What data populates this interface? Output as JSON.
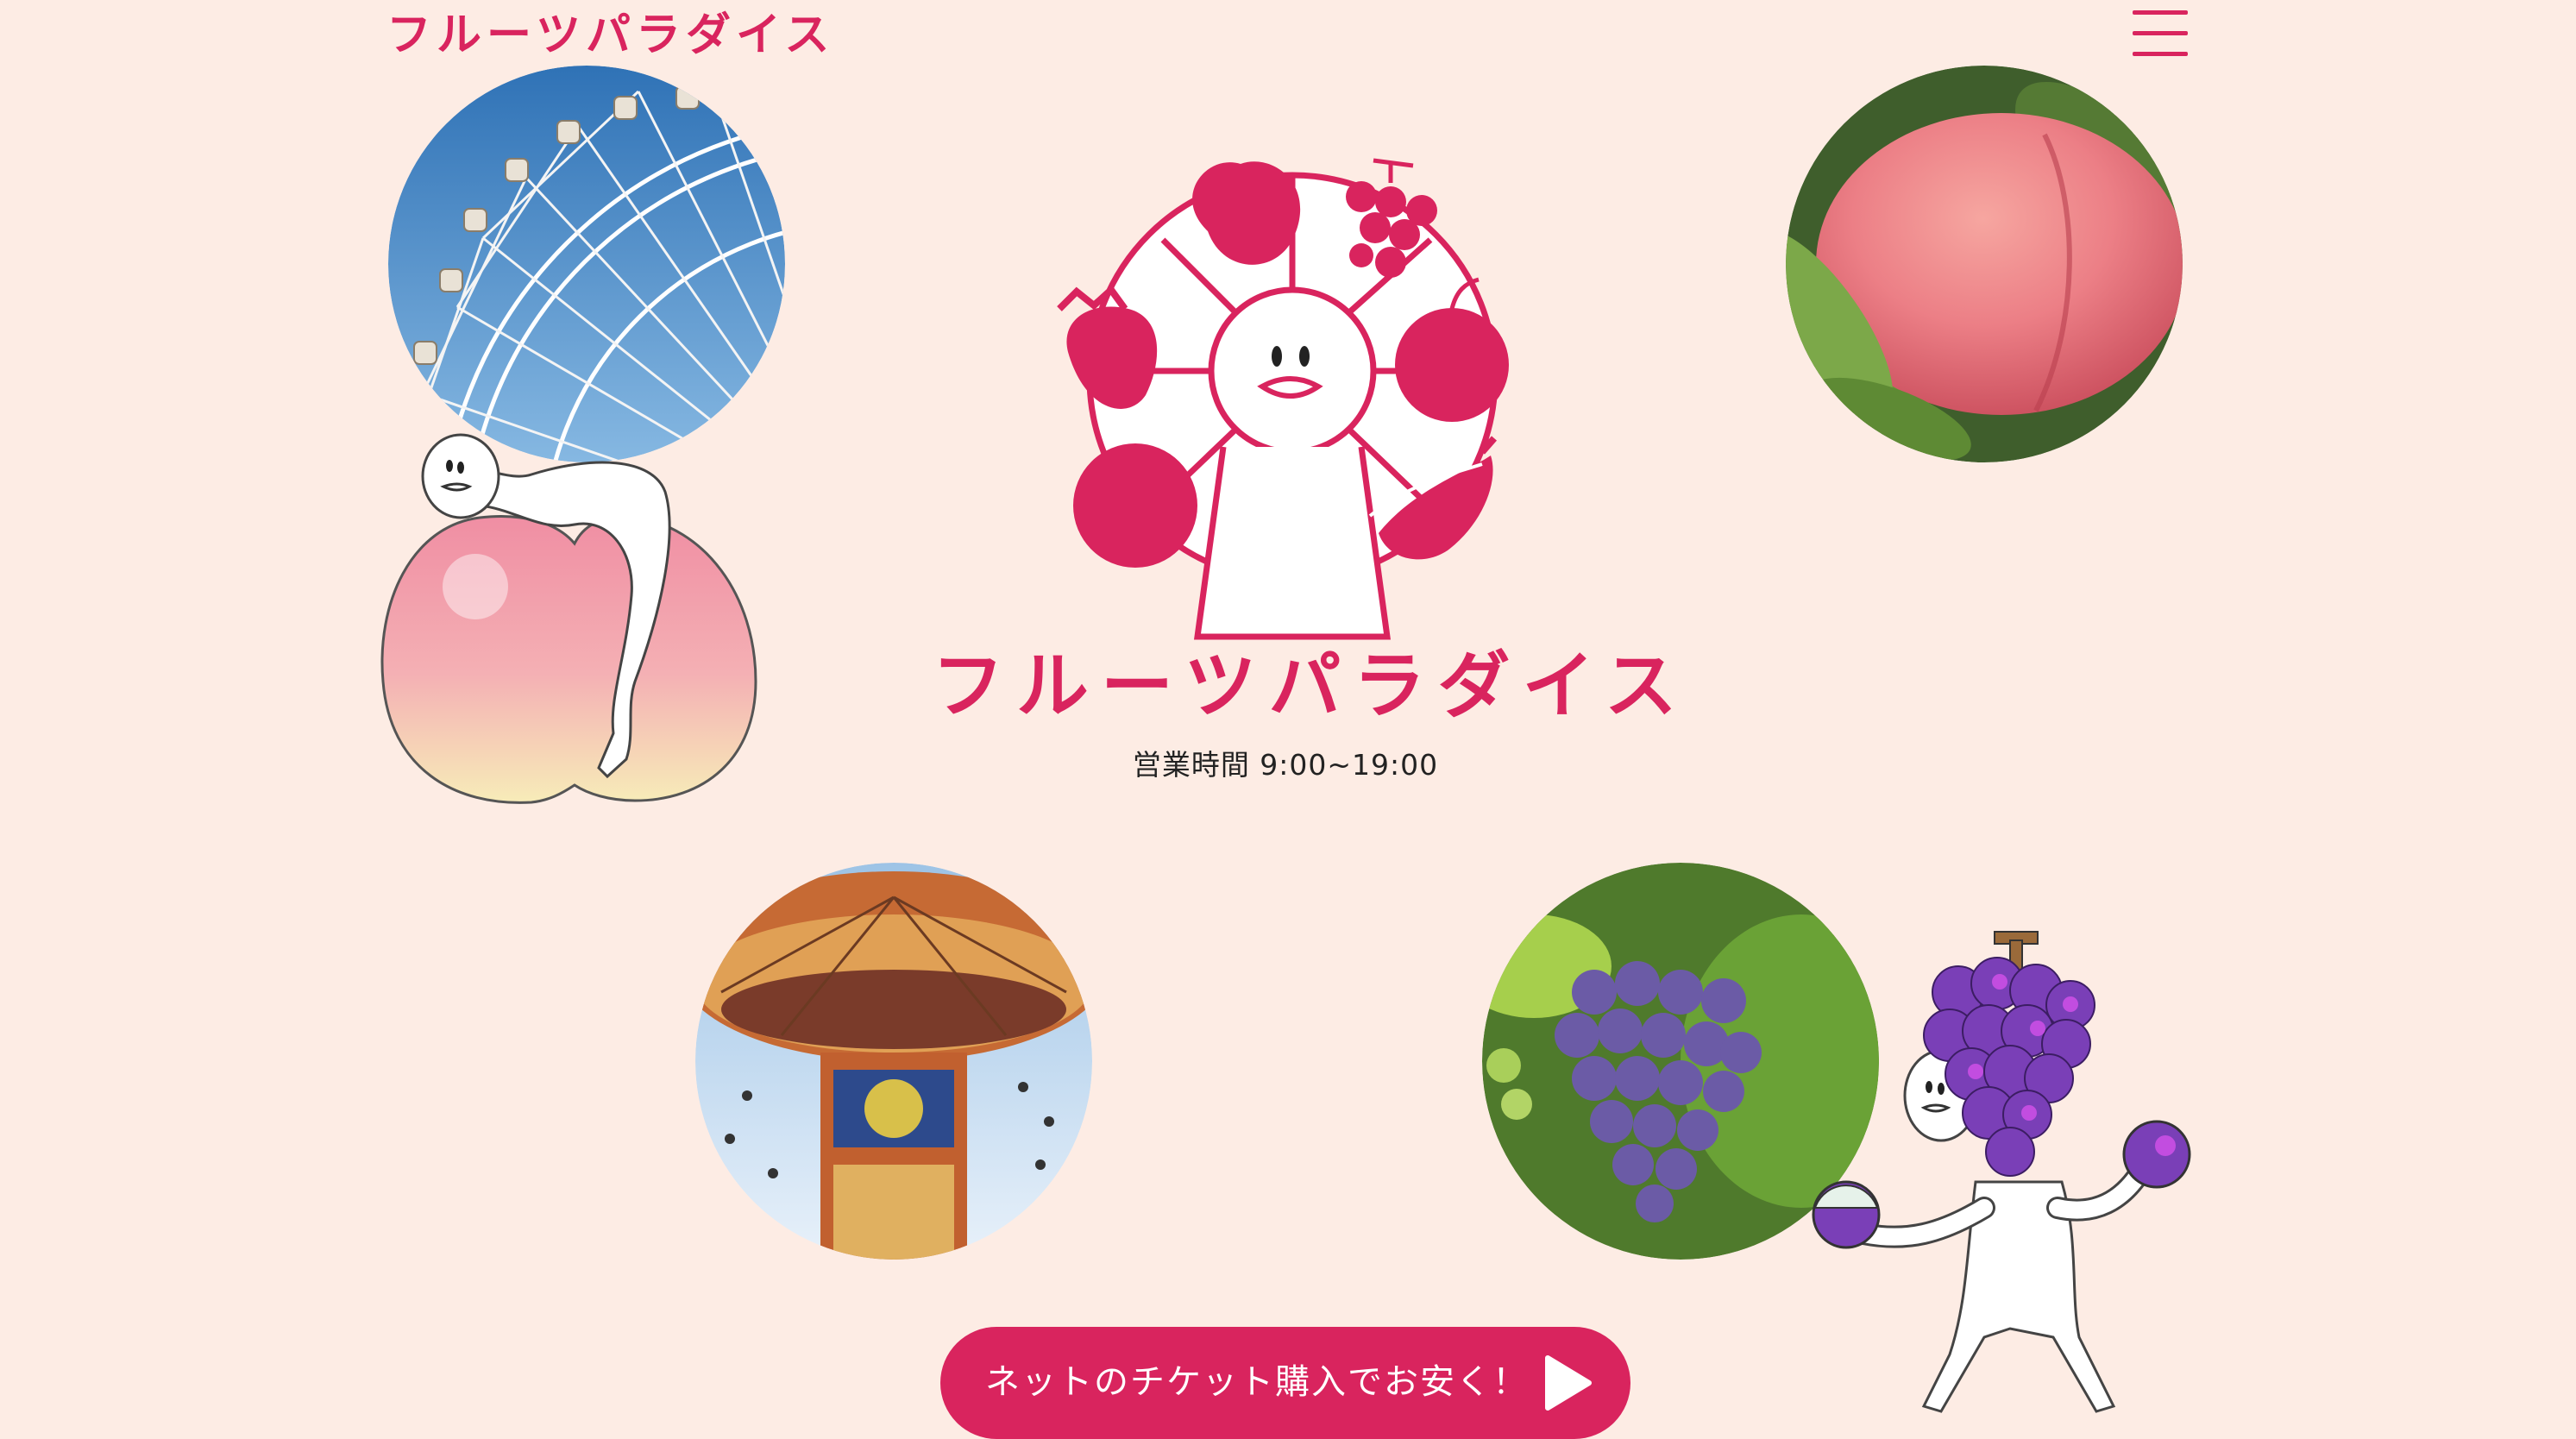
{
  "header": {
    "logo_text": "フルーツパラダイス",
    "menu_icon": "hamburger-menu-icon"
  },
  "hero": {
    "title": "フルーツパラダイス",
    "hours": "営業時間 9:00~19:00"
  },
  "photos": [
    {
      "name": "ferris-wheel-photo"
    },
    {
      "name": "peach-photo"
    },
    {
      "name": "swing-carousel-photo"
    },
    {
      "name": "grapes-photo"
    }
  ],
  "cta": {
    "label": "ネットのチケット購入でお安く！",
    "icon": "play-arrow-icon"
  },
  "colors": {
    "background": "#fdece4",
    "brand": "#d9245e",
    "text": "#222222"
  }
}
